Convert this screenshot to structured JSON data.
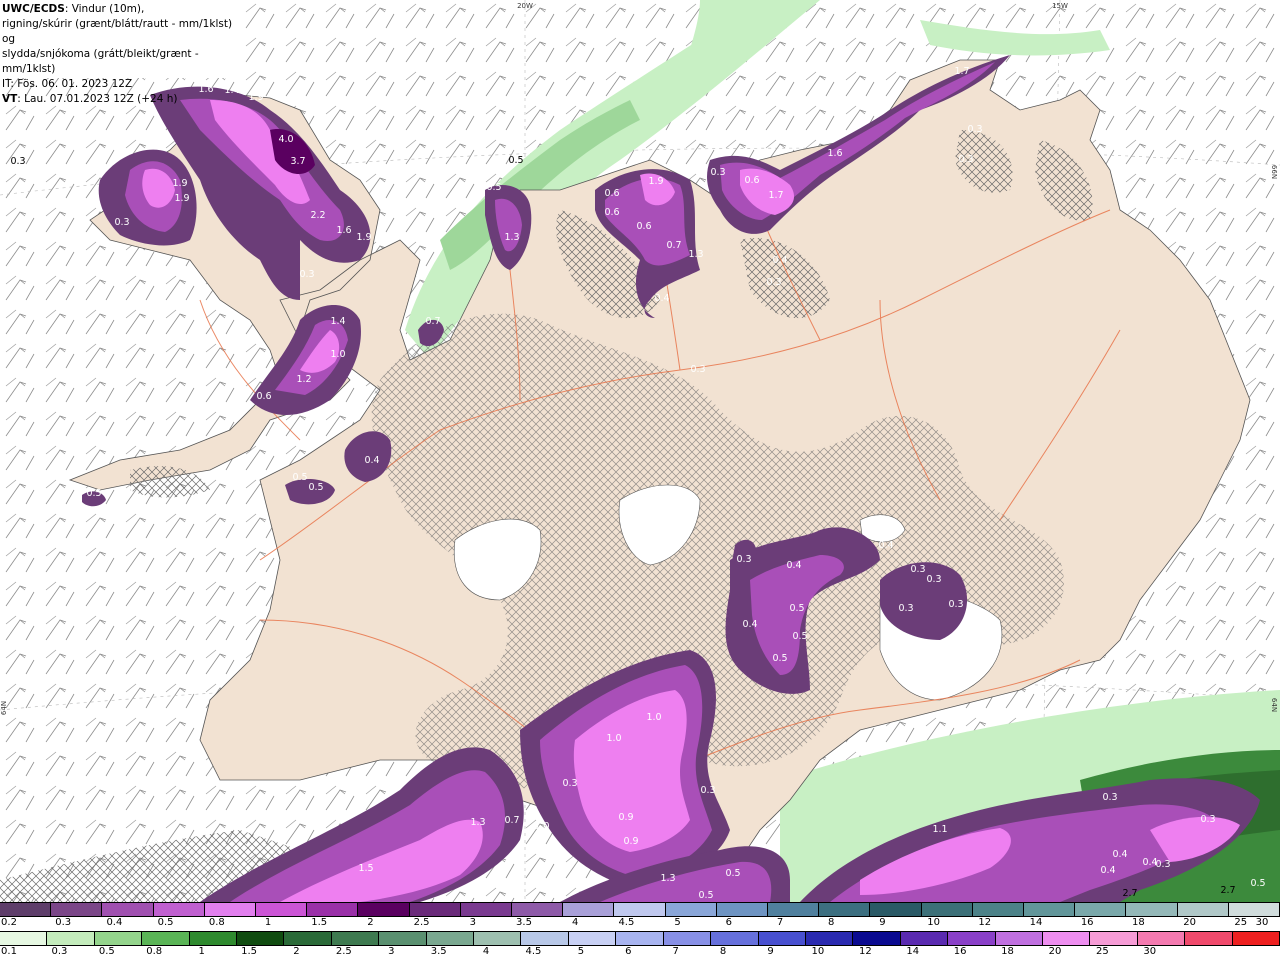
{
  "header": {
    "product": "UWC/ECDS",
    "line1_rest": ": Vindur (10m),",
    "line2": "rigning/skúrir (grænt/blátt/rautt - mm/1klst) og",
    "line3": "slydda/snjókoma (grátt/bleikt/grænt - mm/1klst)",
    "line4": "IT: Fös. 06. 01. 2023 12Z",
    "line5_prefix": "VT",
    "line5_rest": ": Lau. 07.01.2023 12Z  (+24 h)"
  },
  "axis_labels": {
    "top_left": "20W",
    "top_right": "15W",
    "right_top": "66N",
    "right_bottom": "64N",
    "left": "64N"
  },
  "colors": {
    "land": "#f2e2d2",
    "sea": "#ffffff",
    "roads": "#e8744a",
    "snow_light": "#6b3d78",
    "snow_mid": "#a94fb8",
    "snow_high": "#ee7ff0",
    "rain_light": "#c8f0c4",
    "rain_mid": "#9ed79a",
    "rain_dark": "#3c8a3c"
  },
  "map_values": [
    "0.3",
    "1.6",
    "1.4",
    "1.9",
    "4.0",
    "3.7",
    "1.9",
    "1.9",
    "0.3",
    "2.2",
    "1.6",
    "1.9",
    "0.3",
    "1.4",
    "1.0",
    "1.2",
    "0.6",
    "0.5",
    "1.3",
    "0.5",
    "0.7",
    "0.6",
    "0.4",
    "0.5",
    "0.5",
    "0.6",
    "1.9",
    "0.6",
    "0.7",
    "1.3",
    "0.4",
    "0.3",
    "0.5",
    "0.3",
    "1.6",
    "0.6",
    "1.7",
    "1.7",
    "0.3",
    "0.4",
    "0.3",
    "0.3",
    "0.4",
    "0.3",
    "0.3",
    "0.3",
    "0.3",
    "0.4",
    "0.5",
    "0.5",
    "0.5",
    "0.4",
    "1.0",
    "1.0",
    "0.3",
    "0.3",
    "1.3",
    "0.7",
    "1.0",
    "0.9",
    "0.9",
    "1.3",
    "1.5",
    "0.5",
    "0.5",
    "0.3",
    "1.1",
    "0.3",
    "0.4",
    "0.4",
    "0.4",
    "0.3",
    "2.7",
    "2.7",
    "0.5",
    "0.3"
  ],
  "legend_snow": {
    "labels": [
      "0.2",
      "0.3",
      "0.4",
      "0.5",
      "0.8",
      "1",
      "1.5",
      "2",
      "2.5",
      "3",
      "3.5",
      "4",
      "4.5",
      "5",
      "6",
      "7",
      "8",
      "9",
      "10",
      "12",
      "14",
      "16",
      "18",
      "20",
      "25",
      "30"
    ],
    "colors": [
      "#5e3d6a",
      "#7b4688",
      "#a050b0",
      "#c060d0",
      "#e27fee",
      "#cc55d6",
      "#9a30a8",
      "#5a0060",
      "#6a2a7a",
      "#7a3a90",
      "#8e5aa8",
      "#a9a0d8",
      "#c0c8ee",
      "#8aa6d8",
      "#6e94c2",
      "#50809e",
      "#3c6f80",
      "#2a5a66",
      "#3c7078",
      "#4c8288",
      "#62969a",
      "#7aa8aa",
      "#94b8b8",
      "#b0c8c8",
      "#d0dcdc"
    ]
  },
  "legend_rain": {
    "labels": [
      "0.1",
      "0.3",
      "0.5",
      "0.8",
      "1",
      "1.5",
      "2",
      "2.5",
      "3",
      "3.5",
      "4",
      "4.5",
      "5",
      "6",
      "7",
      "8",
      "9",
      "10",
      "12",
      "14",
      "16",
      "18",
      "20",
      "25",
      "30"
    ],
    "colors": [
      "#e6f8e2",
      "#c4ecbc",
      "#94d48c",
      "#5ab456",
      "#2e8a2e",
      "#104c10",
      "#2a6a38",
      "#3e7a50",
      "#5a9070",
      "#7aa890",
      "#9ec0b0",
      "#b8c8e8",
      "#c8d0f4",
      "#a8b4f0",
      "#8890e6",
      "#6670dc",
      "#4850d0",
      "#2a2ab0",
      "#0a0a90",
      "#5a2ab0",
      "#8a40c8",
      "#c070e0",
      "#ee8ef0",
      "#f69cd6",
      "#f47ab0",
      "#f04a6c",
      "#ee2020"
    ]
  }
}
